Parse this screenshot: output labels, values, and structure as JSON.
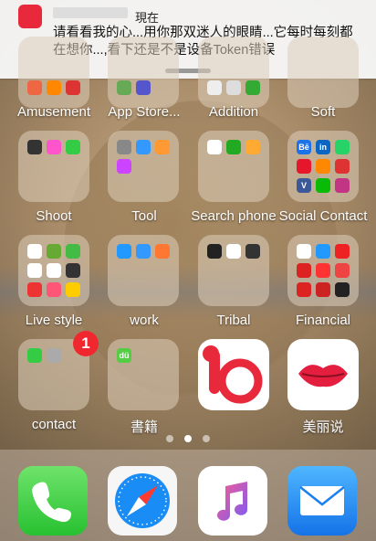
{
  "notification": {
    "time": "現在",
    "message": "请看看我的心...用你那双迷人的眼睛...它每时每刻都在想你...,看下还是不是设备Token错误",
    "app_icon": "red-app-icon"
  },
  "rows": [
    {
      "labels": [
        "Amusement",
        "App Store...",
        "Addition",
        "Soft"
      ]
    },
    {
      "labels": [
        "Shoot",
        "Tool",
        "Search phone",
        "Social Contact"
      ]
    },
    {
      "labels": [
        "Live style",
        "work",
        "Tribal",
        "Financial"
      ]
    },
    {
      "labels": [
        "contact",
        "書籍",
        "",
        "美丽说"
      ]
    }
  ],
  "badges": {
    "contact": "1"
  },
  "page_dots": 3,
  "dock": [
    "phone-icon",
    "safari-icon",
    "music-icon",
    "mail-icon"
  ],
  "colors": {
    "notif_bg": "#f6f6f6",
    "badge": "#f0272e",
    "brand_red": "#e8293b"
  }
}
